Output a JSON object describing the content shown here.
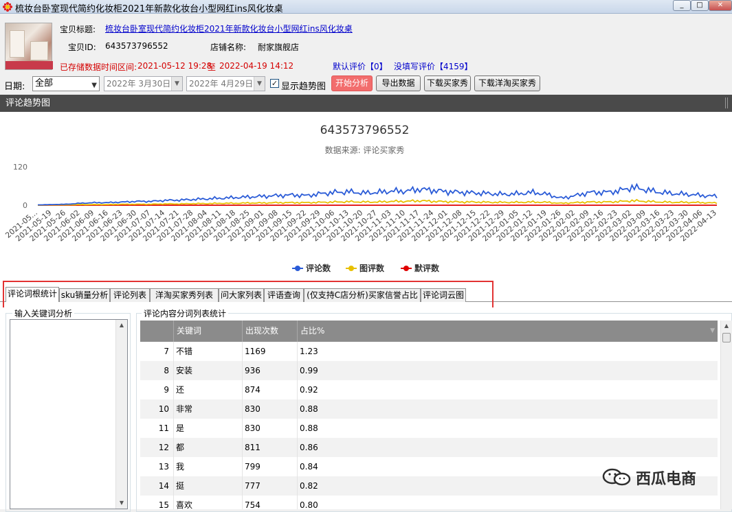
{
  "window": {
    "title": "梳妆台卧室现代简约化妆柜2021年新款化妆台小型网红ins风化妆桌",
    "minimize": "_",
    "maximize": "□",
    "close": "✕"
  },
  "product": {
    "title_label": "宝贝标题:",
    "title_value": "梳妆台卧室现代简约化妆柜2021年新款化妆台小型网红ins风化妆桌",
    "id_label": "宝贝ID:",
    "id_value": "643573796552",
    "shop_label": "店铺名称:",
    "shop_value": "耐家旗舰店",
    "range_label": "已存储数据时间区间:",
    "range_start": "2021-05-12 19:28",
    "range_to": "至",
    "range_end": "2022-04-19 14:12",
    "default_review": "默认评价【0】",
    "unwritten_review": "没填写评价【4159】"
  },
  "controls": {
    "date_label": "日期:",
    "date_select": "全部",
    "start_date": "2022年  3月30日",
    "end_date": "2022年  4月29日",
    "show_trend_label": "显示趋势图",
    "show_trend_checked": "✓",
    "start_btn": "开始分析",
    "export_btn": "导出数据",
    "download_btn": "下载买家秀",
    "download_foreign_btn": "下载洋淘买家秀"
  },
  "section": {
    "title": "评论趋势图"
  },
  "chart_data": {
    "type": "line",
    "title": "643573796552",
    "subtitle": "数据来源: 评论买家秀",
    "y_ticks": [
      "120",
      "0"
    ],
    "ylim": [
      0,
      120
    ],
    "x_labels": [
      "2021-05...",
      "2021-05-19",
      "2021-05-26",
      "2021-06-02",
      "2021-06-09",
      "2021-06-16",
      "2021-06-23",
      "2021-06-30",
      "2021-07-07",
      "2021-07-14",
      "2021-07-21",
      "2021-07-28",
      "2021-08-04",
      "2021-08-11",
      "2021-08-18",
      "2021-08-25",
      "2021-09-01",
      "2021-09-08",
      "2021-09-15",
      "2021-09-22",
      "2021-09-29",
      "2021-10-06",
      "2021-10-13",
      "2021-10-20",
      "2021-10-27",
      "2021-11-03",
      "2021-11-10",
      "2021-11-17",
      "2021-11-24",
      "2021-12-01",
      "2021-12-08",
      "2021-12-15",
      "2021-12-22",
      "2021-12-29",
      "2022-01-05",
      "2022-01-12",
      "2022-01-19",
      "2022-01-26",
      "2022-02-02",
      "2022-02-09",
      "2022-02-16",
      "2022-02-23",
      "2022-03-02",
      "2022-03-09",
      "2022-03-16",
      "2022-03-23",
      "2022-03-30",
      "2022-04-06",
      "2022-04-13"
    ],
    "series": [
      {
        "name": "评论数",
        "color": "#2a5bd7",
        "values": [
          1,
          2,
          3,
          6,
          8,
          8,
          10,
          12,
          12,
          15,
          16,
          18,
          20,
          22,
          24,
          26,
          28,
          30,
          32,
          30,
          36,
          40,
          42,
          38,
          40,
          44,
          44,
          50,
          46,
          42,
          40,
          38,
          36,
          34,
          36,
          40,
          34,
          22,
          30,
          40,
          40,
          44,
          56,
          48,
          40,
          36,
          34,
          30,
          28
        ]
      },
      {
        "name": "图评数",
        "color": "#e8c000",
        "values": [
          0,
          1,
          1,
          2,
          2,
          2,
          3,
          3,
          3,
          4,
          4,
          5,
          5,
          6,
          6,
          7,
          7,
          8,
          8,
          8,
          9,
          10,
          11,
          10,
          10,
          12,
          12,
          14,
          12,
          11,
          10,
          10,
          9,
          9,
          9,
          10,
          9,
          6,
          8,
          10,
          10,
          11,
          14,
          12,
          10,
          9,
          9,
          8,
          7
        ]
      },
      {
        "name": "默评数",
        "color": "#e00000",
        "values": [
          0,
          0,
          0,
          0,
          0,
          0,
          0,
          0,
          0,
          0,
          0,
          0,
          0,
          0,
          0,
          0,
          0,
          0,
          0,
          0,
          0,
          0,
          0,
          0,
          0,
          0,
          0,
          0,
          0,
          0,
          0,
          0,
          0,
          0,
          0,
          0,
          0,
          0,
          0,
          0,
          0,
          0,
          0,
          0,
          0,
          0,
          0,
          0,
          0
        ]
      }
    ],
    "legend_position": "bottom"
  },
  "tabs": [
    {
      "label": "评论词根统计"
    },
    {
      "label": "sku销量分析"
    },
    {
      "label": "评论列表"
    },
    {
      "label": "洋淘买家秀列表"
    },
    {
      "label": "问大家列表"
    },
    {
      "label": "评语查询"
    },
    {
      "label": "(仅支持C店分析)买家信誉占比"
    },
    {
      "label": "评论词云图"
    }
  ],
  "left_group": {
    "title": "输入关键词分析"
  },
  "right_group": {
    "title": "评论内容分词列表统计"
  },
  "table": {
    "headers": [
      "关键词",
      "出现次数",
      "占比%"
    ],
    "rows": [
      {
        "idx": "7",
        "word": "不错",
        "count": "1169",
        "pct": "1.23"
      },
      {
        "idx": "8",
        "word": "安装",
        "count": "936",
        "pct": "0.99"
      },
      {
        "idx": "9",
        "word": "还",
        "count": "874",
        "pct": "0.92"
      },
      {
        "idx": "10",
        "word": "非常",
        "count": "830",
        "pct": "0.88"
      },
      {
        "idx": "11",
        "word": "是",
        "count": "830",
        "pct": "0.88"
      },
      {
        "idx": "12",
        "word": "都",
        "count": "811",
        "pct": "0.86"
      },
      {
        "idx": "13",
        "word": "我",
        "count": "799",
        "pct": "0.84"
      },
      {
        "idx": "14",
        "word": "挺",
        "count": "777",
        "pct": "0.82"
      },
      {
        "idx": "15",
        "word": "喜欢",
        "count": "754",
        "pct": "0.80"
      }
    ]
  },
  "watermark": {
    "text": "西瓜电商"
  }
}
